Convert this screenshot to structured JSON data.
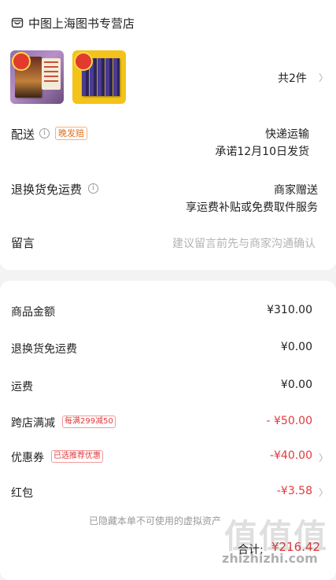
{
  "store": {
    "name": "中图上海图书专营店",
    "icon": "store-icon"
  },
  "items": {
    "count_label": "共2件",
    "thumb1_badge": "",
    "thumb2_badge": ""
  },
  "delivery": {
    "label": "配送",
    "tag": "晚发赔",
    "method": "快递运输",
    "promise": "承诺12月10日发货"
  },
  "return_shipping": {
    "label": "退换货免运费",
    "value": "商家赠送",
    "desc": "享运费补贴或免费取件服务"
  },
  "message": {
    "label": "留言",
    "placeholder": "建议留言前先与商家沟通确认"
  },
  "summary": {
    "goods_amount": {
      "label": "商品金额",
      "value": "¥310.00"
    },
    "return_fee": {
      "label": "退换货免运费",
      "value": "¥0.00"
    },
    "shipping": {
      "label": "运费",
      "value": "¥0.00"
    },
    "cross_store": {
      "label": "跨店满减",
      "tag": "每满299减50",
      "value": "- ¥50.00"
    },
    "coupon": {
      "label": "优惠券",
      "tag": "已选推荐优惠",
      "value": "-¥40.00"
    },
    "red_packet": {
      "label": "红包",
      "value": "-¥3.58"
    },
    "hidden_note": "已隐藏本单不可使用的虚拟资产",
    "total_label": "合计:",
    "total_value": "¥216.42"
  },
  "watermark": {
    "text": "值值值",
    "url": "zhizhizhi.com"
  },
  "colors": {
    "accent_red": "#e4393c",
    "orange_tag": "#e0711f",
    "background": "#f3f3f3"
  }
}
